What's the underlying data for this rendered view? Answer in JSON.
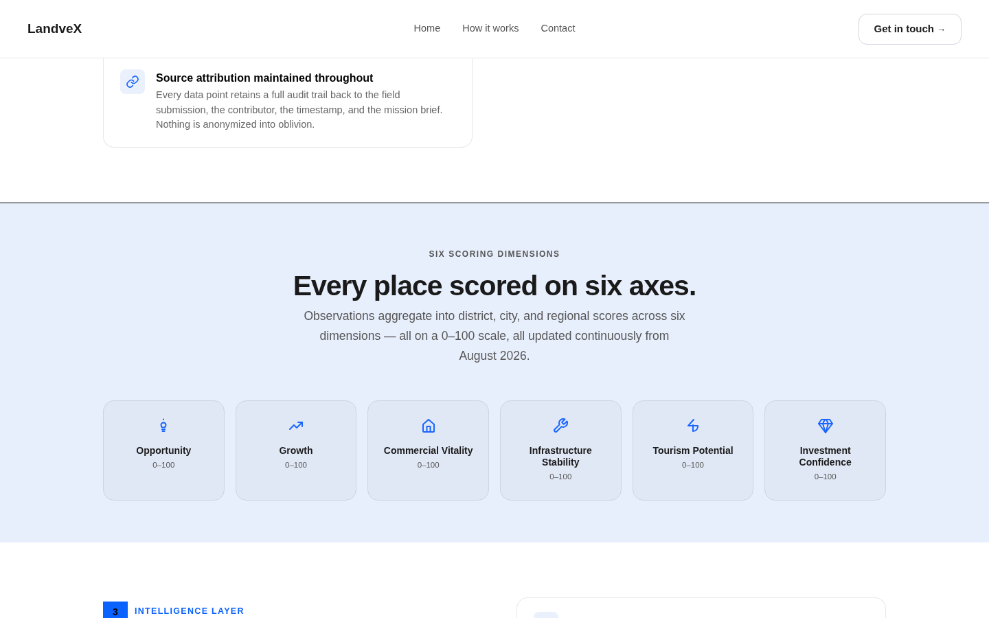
{
  "header": {
    "logo": "LandveX",
    "nav": [
      "Home",
      "How it works",
      "Contact"
    ],
    "cta": "Get in touch",
    "cta_arrow": "→"
  },
  "feature_card": {
    "title": "Source attribution maintained throughout",
    "text": "Every data point retains a full audit trail back to the field submission, the contributor, the timestamp, and the mission brief. Nothing is anonymized into oblivion."
  },
  "dimensions": {
    "eyebrow": "SIX SCORING DIMENSIONS",
    "title": "Every place scored on six axes.",
    "text": "Observations aggregate into district, city, and regional scores across six dimensions — all on a 0–100 scale, all updated continuously from August 2026.",
    "items": [
      {
        "kind": "bulb",
        "name": "Opportunity",
        "range": "0–100"
      },
      {
        "kind": "trend",
        "name": "Growth",
        "range": "0–100"
      },
      {
        "kind": "home",
        "name": "Commercial Vitality",
        "range": "0–100"
      },
      {
        "kind": "wrench",
        "name": "Infrastructure Stability",
        "range": "0–100"
      },
      {
        "kind": "bolt",
        "name": "Tourism Potential",
        "range": "0–100"
      },
      {
        "kind": "gem",
        "name": "Investment Confidence",
        "range": "0–100"
      }
    ]
  },
  "next_section": {
    "number": "3",
    "eyebrow": "INTELLIGENCE LAYER"
  }
}
